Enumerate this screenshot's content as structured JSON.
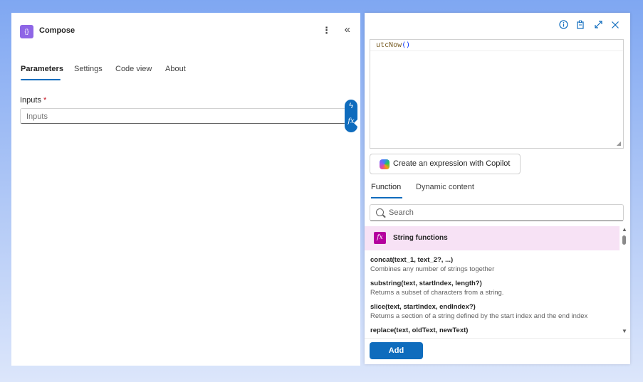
{
  "left_panel": {
    "header": {
      "title": "Compose",
      "icon": "compose-icon",
      "app_icon_glyph": "{}",
      "more_glyph": "⋮",
      "collapse_glyph": "«"
    },
    "tabs": [
      {
        "label": "Parameters",
        "active": true
      },
      {
        "label": "Settings",
        "active": false
      },
      {
        "label": "Code view",
        "active": false
      },
      {
        "label": "About",
        "active": false
      }
    ],
    "inputs": {
      "label": "Inputs",
      "required_mark": "*",
      "placeholder": "Inputs"
    },
    "token_pill": {
      "dynamic_glyph": "ϟ",
      "expression_glyph": "fx"
    }
  },
  "right_panel": {
    "top_icons": [
      "info-icon",
      "copy-icon",
      "expand-icon",
      "close-icon"
    ],
    "expression": {
      "fn": "utcNow",
      "parens": "()"
    },
    "copilot_button": {
      "label": "Create an expression with Copilot"
    },
    "function_tabs": [
      {
        "label": "Function",
        "active": true
      },
      {
        "label": "Dynamic content",
        "active": false
      }
    ],
    "search": {
      "placeholder": "Search"
    },
    "category": {
      "label": "String functions",
      "icon_glyph": "fx",
      "color": "#b4009e"
    },
    "functions": [
      {
        "signature": "concat(text_1, text_2?, ...)",
        "description": "Combines any number of strings together"
      },
      {
        "signature": "substring(text, startIndex, length?)",
        "description": "Returns a subset of characters from a string."
      },
      {
        "signature": "slice(text, startIndex, endIndex?)",
        "description": "Returns a section of a string defined by the start index and the end index"
      },
      {
        "signature": "replace(text, oldText, newText)",
        "description": ""
      }
    ],
    "add_button": {
      "label": "Add"
    }
  },
  "colors": {
    "accent": "#0f6cbd",
    "app_icon": "#8e66e6",
    "category_bg": "#f7e2f5"
  }
}
